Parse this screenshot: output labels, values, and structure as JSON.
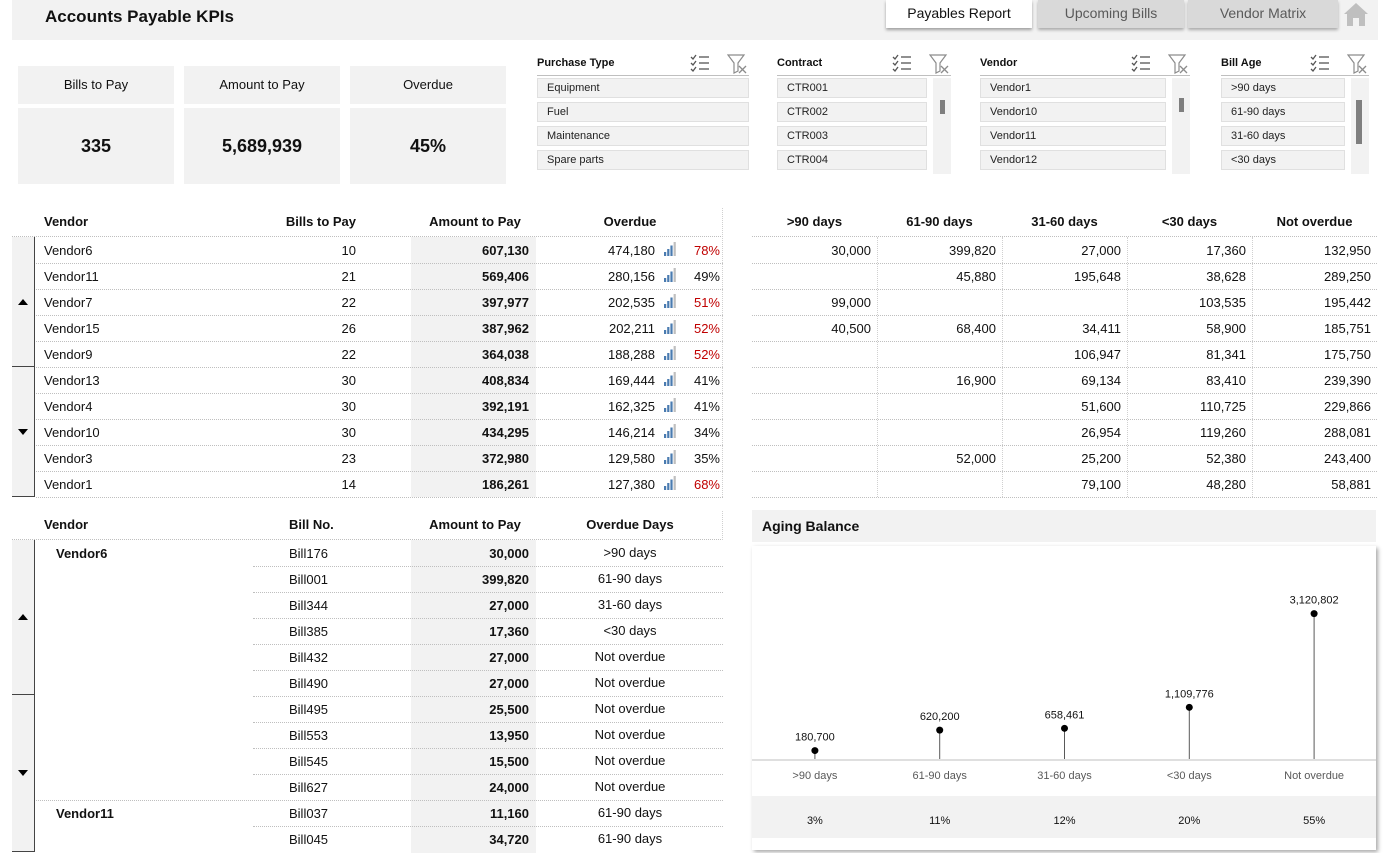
{
  "app": {
    "title": "Accounts Payable KPIs"
  },
  "tabs": [
    {
      "label": "Payables Report",
      "active": true
    },
    {
      "label": "Upcoming Bills",
      "active": false
    },
    {
      "label": "Vendor Matrix",
      "active": false
    }
  ],
  "kpis": {
    "bills": {
      "label": "Bills to Pay",
      "value": "335"
    },
    "amount": {
      "label": "Amount to Pay",
      "value": "5,689,939"
    },
    "overdue": {
      "label": "Overdue",
      "value": "45%"
    }
  },
  "slicers": {
    "purchase_type": {
      "title": "Purchase Type",
      "items": [
        "Equipment",
        "Fuel",
        "Maintenance",
        "Spare parts"
      ]
    },
    "contract": {
      "title": "Contract",
      "items": [
        "CTR001",
        "CTR002",
        "CTR003",
        "CTR004"
      ]
    },
    "vendor": {
      "title": "Vendor",
      "items": [
        "Vendor1",
        "Vendor10",
        "Vendor11",
        "Vendor12"
      ]
    },
    "bill_age": {
      "title": "Bill Age",
      "items": [
        ">90 days",
        "61-90 days",
        "31-60 days",
        "<30 days"
      ]
    }
  },
  "vendor_table": {
    "headers": {
      "vendor": "Vendor",
      "bills": "Bills to Pay",
      "amount": "Amount to Pay",
      "overdue": "Overdue"
    },
    "rows": [
      {
        "vendor": "Vendor6",
        "bills": "10",
        "amount": "607,130",
        "overdue": "474,180",
        "pct": "78%",
        "high": true
      },
      {
        "vendor": "Vendor11",
        "bills": "21",
        "amount": "569,406",
        "overdue": "280,156",
        "pct": "49%",
        "high": false
      },
      {
        "vendor": "Vendor7",
        "bills": "22",
        "amount": "397,977",
        "overdue": "202,535",
        "pct": "51%",
        "high": true
      },
      {
        "vendor": "Vendor15",
        "bills": "26",
        "amount": "387,962",
        "overdue": "202,211",
        "pct": "52%",
        "high": true
      },
      {
        "vendor": "Vendor9",
        "bills": "22",
        "amount": "364,038",
        "overdue": "188,288",
        "pct": "52%",
        "high": true
      },
      {
        "vendor": "Vendor13",
        "bills": "30",
        "amount": "408,834",
        "overdue": "169,444",
        "pct": "41%",
        "high": false
      },
      {
        "vendor": "Vendor4",
        "bills": "30",
        "amount": "392,191",
        "overdue": "162,325",
        "pct": "41%",
        "high": false
      },
      {
        "vendor": "Vendor10",
        "bills": "30",
        "amount": "434,295",
        "overdue": "146,214",
        "pct": "34%",
        "high": false
      },
      {
        "vendor": "Vendor3",
        "bills": "23",
        "amount": "372,980",
        "overdue": "129,580",
        "pct": "35%",
        "high": false
      },
      {
        "vendor": "Vendor1",
        "bills": "14",
        "amount": "186,261",
        "overdue": "127,380",
        "pct": "68%",
        "high": true
      }
    ]
  },
  "aging_table": {
    "headers": [
      ">90 days",
      "61-90 days",
      "31-60 days",
      "<30 days",
      "Not overdue"
    ],
    "rows": [
      [
        "30,000",
        "399,820",
        "27,000",
        "17,360",
        "132,950"
      ],
      [
        "",
        "45,880",
        "195,648",
        "38,628",
        "289,250"
      ],
      [
        "99,000",
        "",
        "",
        "103,535",
        "195,442"
      ],
      [
        "40,500",
        "68,400",
        "34,411",
        "58,900",
        "185,751"
      ],
      [
        "",
        "",
        "106,947",
        "81,341",
        "175,750"
      ],
      [
        "",
        "16,900",
        "69,134",
        "83,410",
        "239,390"
      ],
      [
        "",
        "",
        "51,600",
        "110,725",
        "229,866"
      ],
      [
        "",
        "",
        "26,954",
        "119,260",
        "288,081"
      ],
      [
        "",
        "52,000",
        "25,200",
        "52,380",
        "243,400"
      ],
      [
        "",
        "",
        "79,100",
        "48,280",
        "58,881"
      ]
    ]
  },
  "bills_table": {
    "headers": {
      "vendor": "Vendor",
      "bill": "Bill No.",
      "amount": "Amount to Pay",
      "days": "Overdue Days"
    },
    "rows": [
      {
        "vendor": "Vendor6",
        "bill": "Bill176",
        "amount": "30,000",
        "days": ">90 days"
      },
      {
        "vendor": "",
        "bill": "Bill001",
        "amount": "399,820",
        "days": "61-90 days"
      },
      {
        "vendor": "",
        "bill": "Bill344",
        "amount": "27,000",
        "days": "31-60 days"
      },
      {
        "vendor": "",
        "bill": "Bill385",
        "amount": "17,360",
        "days": "<30 days"
      },
      {
        "vendor": "",
        "bill": "Bill432",
        "amount": "27,000",
        "days": "Not overdue"
      },
      {
        "vendor": "",
        "bill": "Bill490",
        "amount": "27,000",
        "days": "Not overdue"
      },
      {
        "vendor": "",
        "bill": "Bill495",
        "amount": "25,500",
        "days": "Not overdue"
      },
      {
        "vendor": "",
        "bill": "Bill553",
        "amount": "13,950",
        "days": "Not overdue"
      },
      {
        "vendor": "",
        "bill": "Bill545",
        "amount": "15,500",
        "days": "Not overdue"
      },
      {
        "vendor": "",
        "bill": "Bill627",
        "amount": "24,000",
        "days": "Not overdue"
      },
      {
        "vendor": "Vendor11",
        "bill": "Bill037",
        "amount": "11,160",
        "days": "61-90 days"
      },
      {
        "vendor": "",
        "bill": "Bill045",
        "amount": "34,720",
        "days": "61-90 days"
      }
    ]
  },
  "colors": {
    "accent_red": "#c00000",
    "band_gray": "#f2f2f2",
    "bar_icon_blue": "#4a7bb0"
  },
  "chart_data": {
    "type": "scatter",
    "title": "Aging Balance",
    "categories": [
      ">90 days",
      "61-90 days",
      "31-60 days",
      "<30 days",
      "Not overdue"
    ],
    "values": [
      180700,
      620200,
      658461,
      1109776,
      3120802
    ],
    "value_labels": [
      "180,700",
      "620,200",
      "658,461",
      "1,109,776",
      "3,120,802"
    ],
    "shares": [
      "3%",
      "11%",
      "12%",
      "20%",
      "55%"
    ],
    "style": "lollipop",
    "ylim": [
      0,
      3500000
    ],
    "grid": false
  }
}
